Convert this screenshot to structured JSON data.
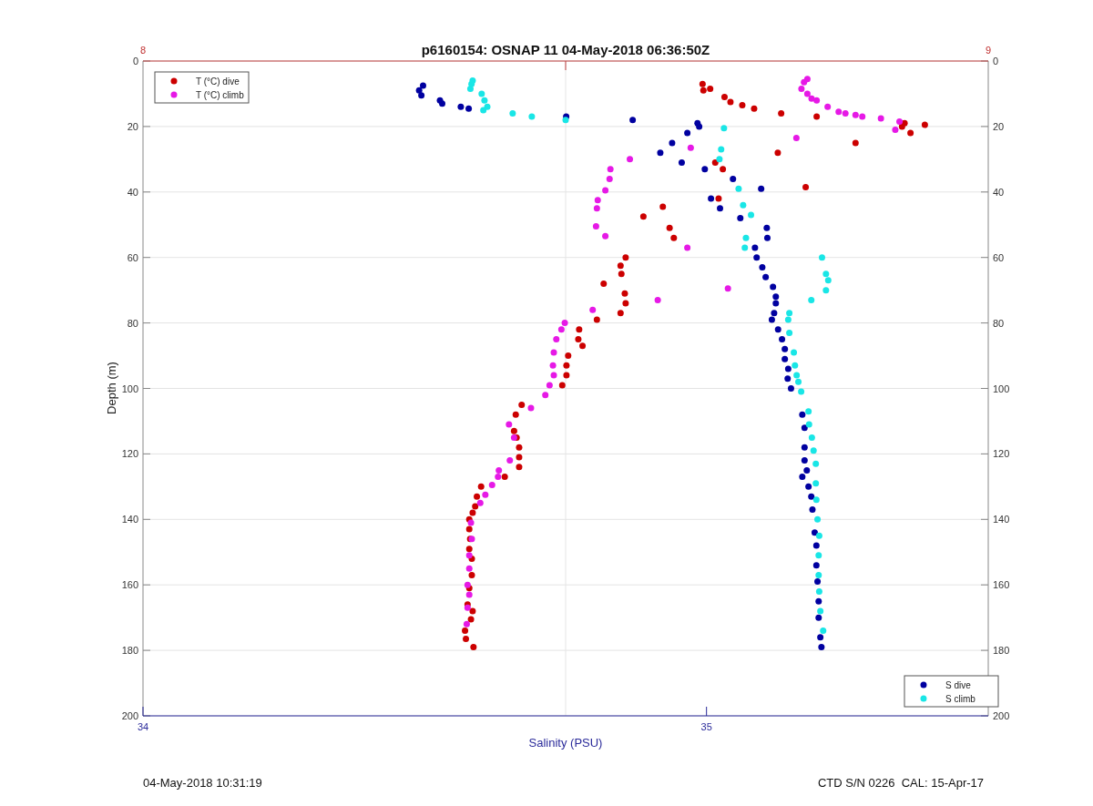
{
  "figure": {
    "chart_data": {
      "type": "scatter",
      "grid": true,
      "legend": [
        "top-left",
        "bottom-right"
      ],
      "title": "p6160154: OSNAP 11 04-May-2018 06:36:50Z",
      "xlabel": "Salinity (PSU)",
      "ylabel": "Depth (m)",
      "xlim": [
        34,
        35.5
      ],
      "xticks": [
        34,
        35
      ],
      "x2lim": [
        8,
        9
      ],
      "x2ticks": [
        8,
        9
      ],
      "ylim": [
        200,
        0
      ],
      "yticks": [
        0,
        20,
        40,
        60,
        80,
        100,
        120,
        140,
        160,
        180,
        200
      ],
      "y2lim": [
        200,
        0
      ],
      "y2ticks": [
        0,
        20,
        40,
        60,
        80,
        100,
        120,
        140,
        160,
        180,
        200
      ],
      "series": [
        {
          "name": "T (°C) dive",
          "color": "#cc0000",
          "axis": "x2",
          "x": [
            8.662,
            8.663,
            8.671,
            8.688,
            8.695,
            8.709,
            8.723,
            8.755,
            8.797,
            8.901,
            8.898,
            8.925,
            8.908,
            8.843,
            8.751,
            8.677,
            8.686,
            8.784,
            8.681,
            8.615,
            8.592,
            8.623,
            8.628,
            8.571,
            8.565,
            8.566,
            8.545,
            8.57,
            8.571,
            8.565,
            8.537,
            8.516,
            8.515,
            8.52,
            8.503,
            8.501,
            8.501,
            8.496,
            8.448,
            8.441,
            8.439,
            8.442,
            8.445,
            8.445,
            8.445,
            8.428,
            8.4,
            8.395,
            8.393,
            8.39,
            8.386,
            8.386,
            8.387,
            8.386,
            8.389,
            8.389,
            8.386,
            8.384,
            8.39,
            8.388,
            8.381,
            8.382,
            8.391
          ],
          "values": [
            7,
            9,
            8.5,
            11,
            12.5,
            13.5,
            14.5,
            16,
            17,
            19,
            20,
            19.5,
            22,
            25,
            28,
            31,
            33,
            38.5,
            42,
            44.5,
            47.5,
            51,
            54,
            60,
            62.5,
            65,
            68,
            71,
            74,
            77,
            79,
            82,
            85,
            87,
            90,
            93,
            96,
            99,
            105,
            108,
            113,
            115,
            118,
            121,
            124,
            127,
            130,
            133,
            136,
            138,
            140,
            143,
            146,
            149,
            152,
            157,
            161,
            166,
            168,
            170.5,
            174,
            176.5,
            179
          ]
        },
        {
          "name": "T (°C) climb",
          "color": "#e619e6",
          "axis": "x2",
          "x": [
            8.786,
            8.782,
            8.779,
            8.786,
            8.791,
            8.797,
            8.81,
            8.823,
            8.831,
            8.843,
            8.851,
            8.873,
            8.895,
            8.89,
            8.773,
            8.648,
            8.576,
            8.553,
            8.552,
            8.547,
            8.538,
            8.537,
            8.536,
            8.547,
            8.644,
            8.692,
            8.609,
            8.532,
            8.499,
            8.495,
            8.489,
            8.486,
            8.485,
            8.486,
            8.481,
            8.476,
            8.459,
            8.433,
            8.439,
            8.434,
            8.421,
            8.42,
            8.413,
            8.405,
            8.399,
            8.388,
            8.389,
            8.386,
            8.386,
            8.384,
            8.386,
            8.384,
            8.383
          ],
          "values": [
            5.5,
            6.5,
            8.5,
            10,
            11.5,
            12,
            14,
            15.5,
            16,
            16.5,
            17,
            17.5,
            18.5,
            21,
            23.5,
            26.5,
            30,
            33,
            36,
            39.5,
            42.5,
            45,
            50.5,
            53.5,
            57,
            69.5,
            73,
            76,
            80,
            82,
            85,
            89,
            93,
            96,
            99,
            102,
            106,
            111,
            115,
            122,
            125,
            127,
            129.5,
            132.5,
            135,
            141,
            146,
            151,
            155,
            160,
            163,
            167,
            172
          ]
        },
        {
          "name": "S dive",
          "color": "#0000a0",
          "x": [
            34.494,
            34.49,
            34.497,
            34.527,
            34.531,
            34.564,
            34.578,
            34.751,
            34.869,
            34.984,
            34.987,
            34.966,
            34.939,
            34.918,
            34.956,
            34.997,
            35.047,
            35.097,
            35.008,
            35.024,
            35.06,
            35.107,
            35.108,
            35.086,
            35.089,
            35.099,
            35.105,
            35.118,
            35.123,
            35.123,
            35.12,
            35.116,
            35.127,
            35.134,
            35.139,
            35.139,
            35.145,
            35.144,
            35.15,
            35.17,
            35.174,
            35.174,
            35.174,
            35.178,
            35.17,
            35.181,
            35.186,
            35.188,
            35.192,
            35.195,
            35.195,
            35.197,
            35.199,
            35.199,
            35.202,
            35.204
          ],
          "values": [
            10.5,
            9,
            7.5,
            12,
            13,
            14,
            14.5,
            17,
            18,
            19,
            20,
            22,
            25,
            28,
            31,
            33,
            36,
            39,
            42,
            45,
            48,
            51,
            54,
            57,
            60,
            63,
            66,
            69,
            72,
            74,
            77,
            79,
            82,
            85,
            88,
            91,
            94,
            97,
            100,
            108,
            112,
            118,
            122,
            125,
            127,
            130,
            133,
            137,
            144,
            148,
            154,
            159,
            165,
            170,
            176,
            179
          ]
        },
        {
          "name": "S climb",
          "color": "#19e6e6",
          "x": [
            34.585,
            34.583,
            34.581,
            34.601,
            34.606,
            34.611,
            34.604,
            34.656,
            34.69,
            34.75,
            35.031,
            35.026,
            35.023,
            35.057,
            35.065,
            35.079,
            35.07,
            35.068,
            35.205,
            35.212,
            35.216,
            35.212,
            35.186,
            35.147,
            35.145,
            35.147,
            35.155,
            35.157,
            35.16,
            35.163,
            35.168,
            35.181,
            35.182,
            35.187,
            35.19,
            35.194,
            35.194,
            35.195,
            35.197,
            35.2,
            35.199,
            35.199,
            35.2,
            35.202,
            35.207
          ],
          "values": [
            6,
            7,
            8.5,
            10,
            12,
            14,
            15,
            16,
            17,
            18,
            20.5,
            27,
            30,
            39,
            44,
            47,
            54,
            57,
            60,
            65,
            67,
            70,
            73,
            77,
            79,
            83,
            89,
            93,
            96,
            98,
            101,
            107,
            111,
            115,
            119,
            123,
            129,
            134,
            140,
            145,
            151,
            157,
            162,
            168,
            174
          ]
        }
      ]
    }
  },
  "timestamp": "04-May-2018 10:31:19",
  "instrument": "CTD S/N 0226  CAL: 15-Apr-17"
}
